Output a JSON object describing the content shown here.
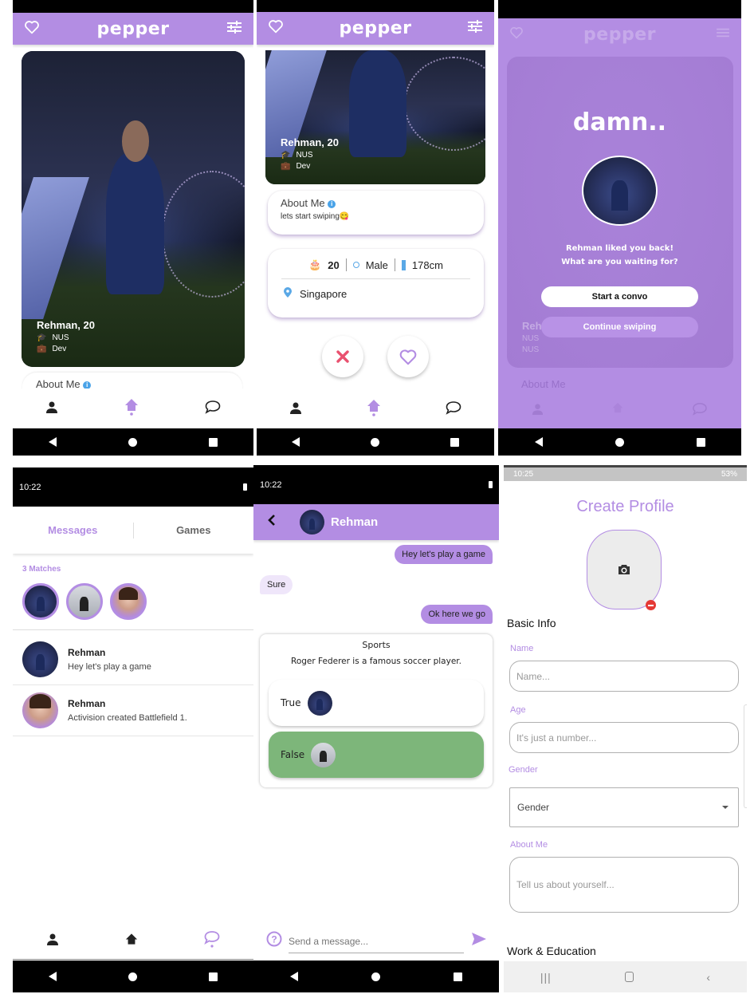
{
  "app": {
    "name": "pepper",
    "accent_color": "#b38de3"
  },
  "screen1": {
    "profile": {
      "name_age": "Rehman, 20",
      "school": "NUS",
      "job": "Dev"
    },
    "about_title": "About Me"
  },
  "screen2": {
    "profile": {
      "name_age": "Rehman, 20",
      "school": "NUS",
      "job": "Dev"
    },
    "about_title": "About Me",
    "about_text": "lets start swiping😋",
    "stats": {
      "age": "20",
      "gender": "Male",
      "height": "178cm"
    },
    "location": "Singapore"
  },
  "screen3": {
    "title": "damn..",
    "message_line1": "Rehman liked you back!",
    "message_line2": "What are you waiting for?",
    "start_convo": "Start a convo",
    "continue_swiping": "Continue swiping",
    "bg_name": "Reh",
    "bg_school": "NUS",
    "bg_job": "NUS",
    "bg_about": "About Me"
  },
  "screen4": {
    "time": "10:22",
    "tabs": [
      {
        "label": "Messages",
        "active": true
      },
      {
        "label": "Games",
        "active": false
      }
    ],
    "matches_label": "3 Matches",
    "chats": [
      {
        "name": "Rehman",
        "preview": "Hey let's play a game"
      },
      {
        "name": "Rehman",
        "preview": "Activision created Battlefield 1."
      }
    ]
  },
  "screen5": {
    "time": "10:22",
    "contact_name": "Rehman",
    "messages": [
      {
        "from": "me",
        "text": "Hey let's play a game"
      },
      {
        "from": "them",
        "text": "Sure"
      },
      {
        "from": "me",
        "text": "Ok here we go"
      }
    ],
    "quiz": {
      "category": "Sports",
      "question": "Roger Federer is a famous soccer player.",
      "options": [
        {
          "label": "True",
          "selected": false
        },
        {
          "label": "False",
          "selected": true,
          "color": "#7db67a"
        }
      ]
    },
    "input_placeholder": "Send a message..."
  },
  "screen6": {
    "status": {
      "time": "10:25",
      "battery": "53%"
    },
    "title": "Create Profile",
    "section_basic": "Basic Info",
    "fields": {
      "name_label": "Name",
      "name_placeholder": "Name...",
      "age_label": "Age",
      "age_placeholder": "It's just a number...",
      "gender_label": "Gender",
      "gender_value": "Gender",
      "about_label": "About Me",
      "about_placeholder": "Tell us about yourself..."
    },
    "section_work": "Work & Education"
  }
}
